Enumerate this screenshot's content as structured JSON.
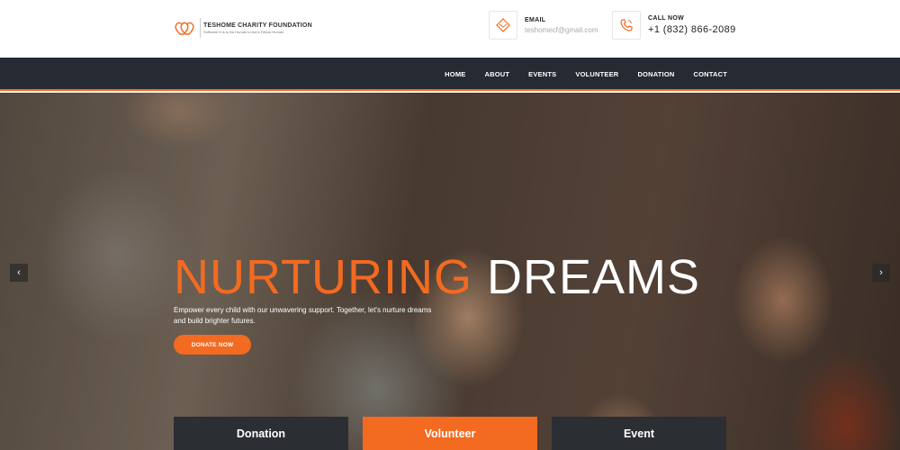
{
  "brand": {
    "name": "TESHOME CHARITY FOUNDATION",
    "tagline": "Sufficient It is to Be Human to Aid a Fellow Human",
    "logo_icon": "double-heart-icon",
    "accent_color": "#f36a21",
    "nav_bg_color": "#262b33"
  },
  "contact": {
    "email": {
      "label": "EMAIL",
      "value": "teshomecf@gmail.com",
      "icon": "diamond-mail-icon"
    },
    "phone": {
      "label": "CALL NOW",
      "value": "+1 (832) 866-2089",
      "icon": "phone-icon"
    }
  },
  "nav": {
    "items": [
      "HOME",
      "ABOUT",
      "EVENTS",
      "VOLUNTEER",
      "DONATION",
      "CONTACT"
    ]
  },
  "hero": {
    "headline_part1": "NURTURING",
    "headline_part2": "DREAMS",
    "subtext": "Empower every child with our unwavering support. Together, let's nurture dreams and build brighter futures.",
    "cta_label": "DONATE NOW",
    "prev_icon": "chevron-left-icon",
    "next_icon": "chevron-right-icon",
    "prev_glyph": "‹",
    "next_glyph": "›"
  },
  "cards": [
    "Donation",
    "Volunteer",
    "Event"
  ]
}
